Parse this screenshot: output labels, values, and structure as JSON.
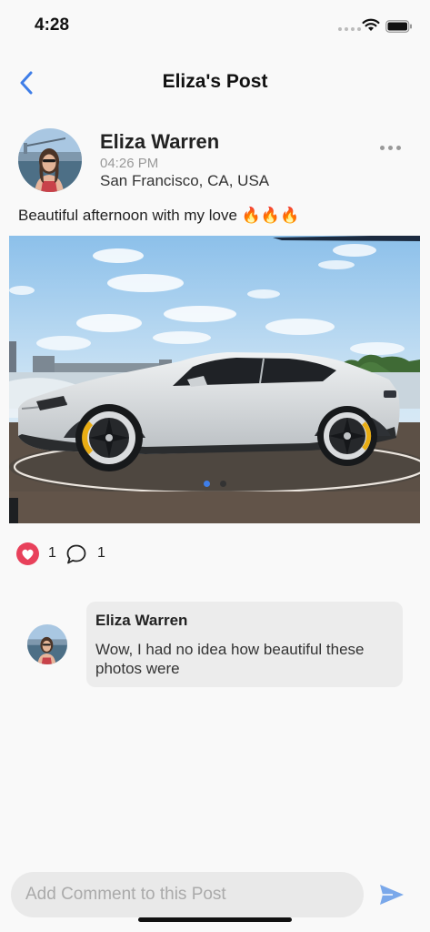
{
  "status_bar": {
    "time": "4:28",
    "icons": [
      "signal-dots-icon",
      "wifi-icon",
      "battery-icon"
    ]
  },
  "nav": {
    "title": "Eliza's Post",
    "back_icon": "chevron-left-icon"
  },
  "post": {
    "author_name": "Eliza Warren",
    "time": "04:26 PM",
    "location": "San Francisco, CA, USA",
    "caption": "Beautiful afternoon with my love 🔥🔥🔥",
    "more_icon": "more-horizontal-icon",
    "photo": {
      "subject": "white sports sedan",
      "page_count": 2,
      "current_page": 1
    }
  },
  "reactions": {
    "like_icon": "heart-icon",
    "like_count": "1",
    "comment_icon": "speech-bubble-icon",
    "comment_count": "1"
  },
  "comments": [
    {
      "author": "Eliza Warren",
      "text": "Wow, I had no idea how beautiful these photos were"
    }
  ],
  "composer": {
    "placeholder": "Add Comment to this Post",
    "send_icon": "send-icon"
  },
  "colors": {
    "accent": "#3f7ee8",
    "like": "#e8415b",
    "background": "#f9f9f9",
    "bubble": "#ececec"
  }
}
